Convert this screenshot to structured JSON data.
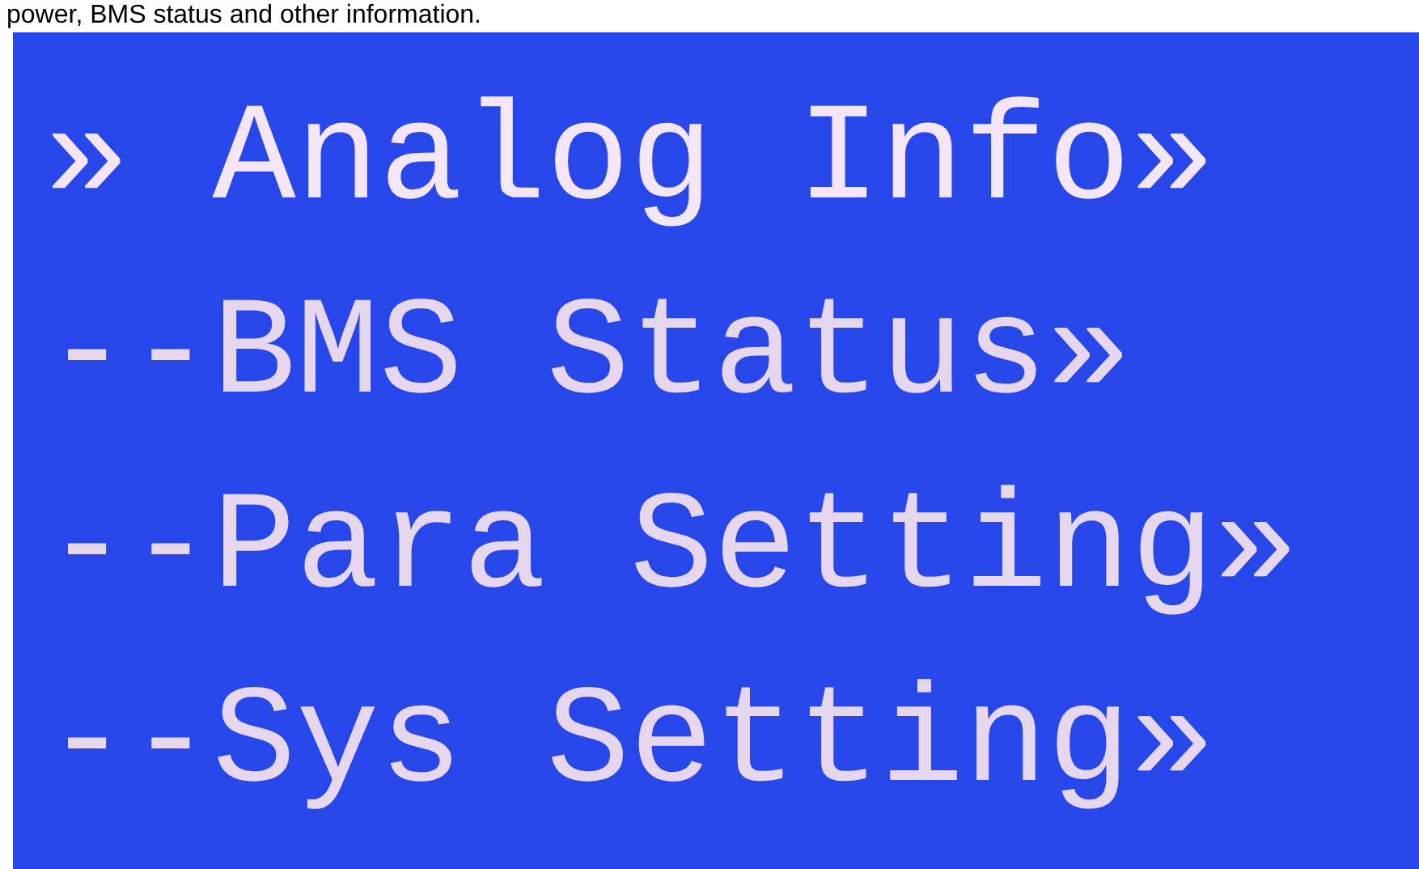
{
  "caption": "power, BMS status and other information.",
  "menu": [
    {
      "prefix": "»",
      "label": "Analog Info",
      "arrow": "»",
      "selected": true
    },
    {
      "prefix": "--",
      "label": "BMS Status",
      "arrow": "»",
      "selected": false
    },
    {
      "prefix": "--",
      "label": "Para Setting",
      "arrow": "»",
      "selected": false
    },
    {
      "prefix": "--",
      "label": "Sys Setting",
      "arrow": "»",
      "selected": false
    }
  ]
}
